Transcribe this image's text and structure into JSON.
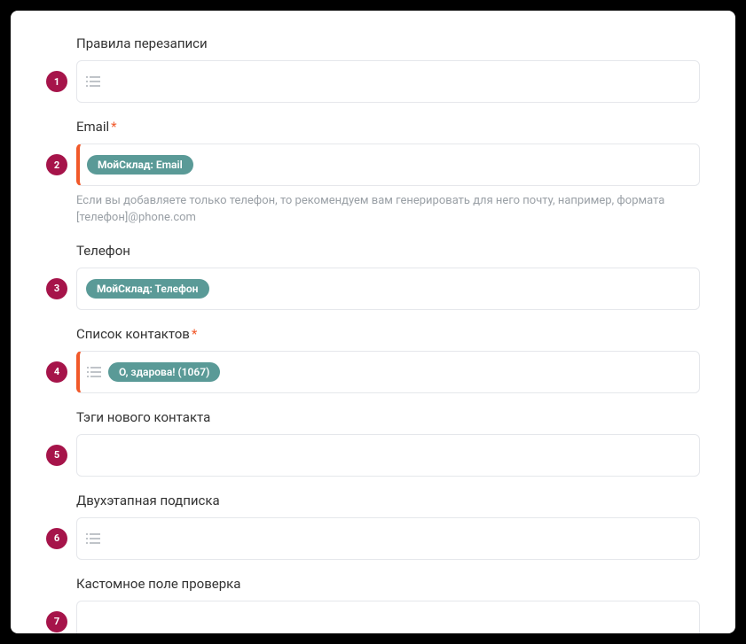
{
  "fields": [
    {
      "num": "1",
      "label": "Правила перезаписи",
      "required": false,
      "accent": false,
      "listIcon": true,
      "tags": [],
      "help": ""
    },
    {
      "num": "2",
      "label": "Email",
      "required": true,
      "accent": true,
      "listIcon": false,
      "tags": [
        {
          "prefix": "МойСклад:",
          "text": " Email"
        }
      ],
      "help": "Если вы добавляете только телефон, то рекомендуем вам генерировать для него почту, например, формата [телефон]@phone.com"
    },
    {
      "num": "3",
      "label": "Телефон",
      "required": false,
      "accent": false,
      "listIcon": false,
      "tags": [
        {
          "prefix": "МойСклад:",
          "text": " Телефон"
        }
      ],
      "help": ""
    },
    {
      "num": "4",
      "label": "Список контактов",
      "required": true,
      "accent": true,
      "listIcon": true,
      "tags": [
        {
          "prefix": "",
          "text": "О, здарова! (1067)"
        }
      ],
      "help": ""
    },
    {
      "num": "5",
      "label": "Тэги нового контакта",
      "required": false,
      "accent": false,
      "listIcon": false,
      "tags": [],
      "help": ""
    },
    {
      "num": "6",
      "label": "Двухэтапная подписка",
      "required": false,
      "accent": false,
      "listIcon": true,
      "tags": [],
      "help": ""
    },
    {
      "num": "7",
      "label": "Кастомное поле проверка",
      "required": false,
      "accent": false,
      "listIcon": false,
      "tags": [],
      "help": ""
    }
  ],
  "requiredMark": "*"
}
